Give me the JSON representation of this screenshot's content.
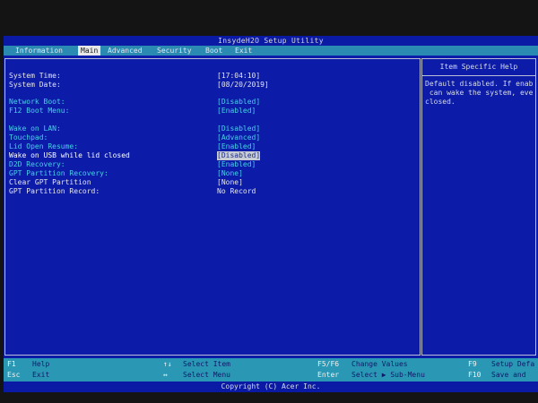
{
  "title": "InsydeH2O Setup Utility",
  "menu": [
    {
      "label": "Information",
      "active": false
    },
    {
      "label": "Main",
      "active": true
    },
    {
      "label": "Advanced",
      "active": false
    },
    {
      "label": "Security",
      "active": false
    },
    {
      "label": "Boot",
      "active": false
    },
    {
      "label": "Exit",
      "active": false
    }
  ],
  "settings": [
    {
      "label": "System Time:",
      "value": "[17:04:10]"
    },
    {
      "label": "System Date:",
      "value": "[08/20/2019]"
    },
    {
      "label": "Network Boot:",
      "value": "[Disabled]"
    },
    {
      "label": "F12 Boot Menu:",
      "value": "[Enabled]"
    },
    {
      "label": "Wake on LAN:",
      "value": "[Disabled]"
    },
    {
      "label": "Touchpad:",
      "value": "[Advanced]"
    },
    {
      "label": "Lid Open Resume:",
      "value": "[Enabled]"
    },
    {
      "label": "Wake on USB while lid closed",
      "value": "[Disabled]"
    },
    {
      "label": "D2D Recovery:",
      "value": "[Enabled]"
    },
    {
      "label": "GPT Partition Recovery:",
      "value": "[None]"
    },
    {
      "label": "Clear GPT Partition",
      "value": "[None]"
    },
    {
      "label": "GPT Partition Record:",
      "value": "No Record"
    }
  ],
  "help": {
    "title": "Item Specific Help",
    "text": "Default disabled. If enab\n can wake the system, eve\nclosed."
  },
  "footer": {
    "keys": [
      {
        "key": "F1",
        "desc": "Help"
      },
      {
        "key": "Esc",
        "desc": "Exit"
      },
      {
        "key": "↑↓",
        "desc": "Select Item"
      },
      {
        "key": "↔",
        "desc": "Select Menu"
      },
      {
        "key": "F5/F6",
        "desc": "Change Values"
      },
      {
        "key": "Enter",
        "desc": "Select ▶ Sub-Menu"
      },
      {
        "key": "F9",
        "desc": "Setup Defa"
      },
      {
        "key": "F10",
        "desc": "Save and"
      }
    ],
    "copyright": "Copyright (C) Acer Inc."
  }
}
